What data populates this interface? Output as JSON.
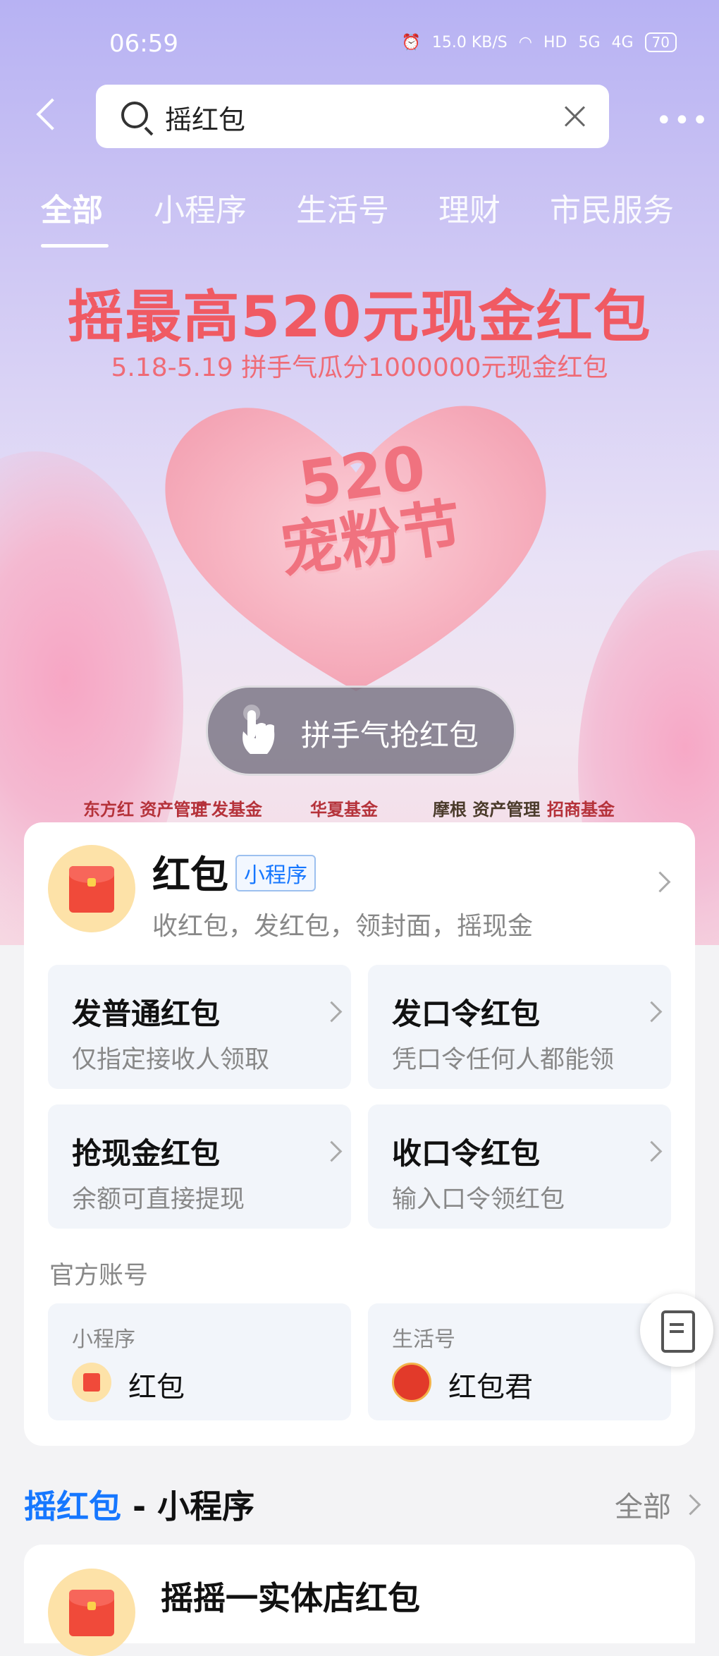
{
  "status_bar": {
    "time": "06:59",
    "speed": "15.0 KB/S",
    "network_hd": "HD",
    "net1": "5G",
    "net2": "4G",
    "battery": "70"
  },
  "search": {
    "query": "摇红包"
  },
  "tabs": [
    {
      "label": "全部",
      "active": true
    },
    {
      "label": "小程序"
    },
    {
      "label": "生活号"
    },
    {
      "label": "理财"
    },
    {
      "label": "市民服务"
    }
  ],
  "banner": {
    "title": "摇最高520元现金红包",
    "subtitle": "5.18-5.19 拼手气瓜分1000000元现金红包",
    "heart_text_1": "520",
    "heart_text_2": "宠粉节",
    "cta": "拼手气抢红包",
    "sponsors": [
      "东方红 资产管理",
      "广发基金",
      "华夏基金",
      "摩根 资产管理",
      "招商基金"
    ]
  },
  "app": {
    "name": "红包",
    "badge": "小程序",
    "desc": "收红包，发红包，领封面，摇现金",
    "actions": [
      {
        "title": "发普通红包",
        "sub": "仅指定接收人领取"
      },
      {
        "title": "发口令红包",
        "sub": "凭口令任何人都能领"
      },
      {
        "title": "抢现金红包",
        "sub": "余额可直接提现"
      },
      {
        "title": "收口令红包",
        "sub": "输入口令领红包"
      }
    ],
    "official_label": "官方账号",
    "accounts": [
      {
        "kind": "小程序",
        "name": "红包"
      },
      {
        "kind": "生活号",
        "name": "红包君"
      }
    ]
  },
  "section": {
    "title_highlight": "摇红包",
    "title_rest": " - 小程序",
    "all": "全部",
    "first_item": "摇摇一实体店红包"
  },
  "colors": {
    "accent": "#1677ff",
    "banner_red": "#f05a63",
    "envelope_red": "#f04a3a"
  }
}
